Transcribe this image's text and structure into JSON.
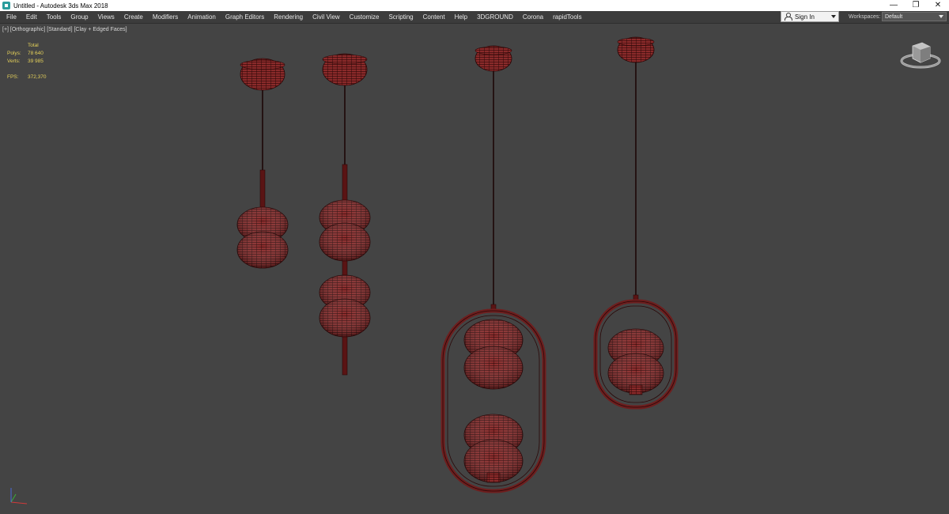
{
  "window": {
    "title": "Untitled - Autodesk 3ds Max 2018",
    "controls": {
      "minimize": "—",
      "restore": "❐",
      "close": "✕"
    }
  },
  "menu": {
    "items": [
      "File",
      "Edit",
      "Tools",
      "Group",
      "Views",
      "Create",
      "Modifiers",
      "Animation",
      "Graph Editors",
      "Rendering",
      "Civil View",
      "Customize",
      "Scripting",
      "Content",
      "Help",
      "3DGROUND",
      "Corona",
      "rapidTools"
    ],
    "sign_in": "Sign In",
    "workspaces_label": "Workspaces:",
    "workspaces_value": "Default"
  },
  "viewport": {
    "label": "[+] [Orthographic] [Standard] [Clay + Edged Faces]",
    "stats": {
      "header": "Total",
      "polys_label": "Polys:",
      "polys_value": "78 640",
      "verts_label": "Verts:",
      "verts_value": "39 985",
      "fps_label": "FPS:",
      "fps_value": "372,370"
    }
  },
  "colors": {
    "viewport_bg": "#444444",
    "model_fill": "#8a2a2a",
    "model_wire": "#2a0707",
    "stats_text": "#e5d15a"
  },
  "icons": [
    "app-icon",
    "user-icon",
    "dropdown-caret-icon",
    "viewcube-icon",
    "axis-tripod-icon"
  ]
}
